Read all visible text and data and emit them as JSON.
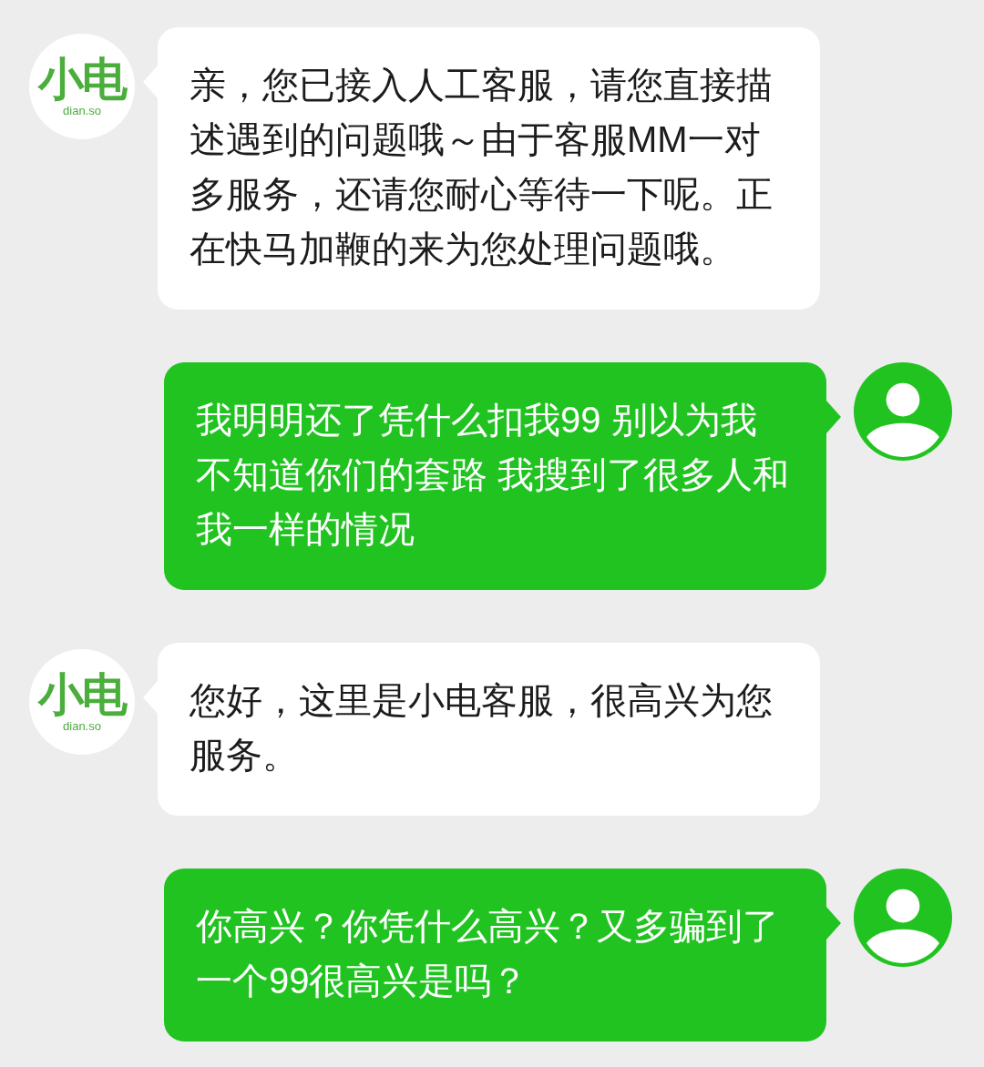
{
  "messages": [
    {
      "kind": "incoming",
      "avatar": {
        "kind": "logo",
        "mark": "小电",
        "caption": "dian.so"
      },
      "text": "亲，您已接入人工客服，请您直接描述遇到的问题哦～由于客服MM一对多服务，还请您耐心等待一下呢。正在快马加鞭的来为您处理问题哦。"
    },
    {
      "kind": "outgoing",
      "avatar": {
        "kind": "silhouette"
      },
      "text": "我明明还了凭什么扣我99 别以为我不知道你们的套路 我搜到了很多人和我一样的情况"
    },
    {
      "kind": "incoming",
      "avatar": {
        "kind": "logo",
        "mark": "小电",
        "caption": "dian.so"
      },
      "text": "您好，这里是小电客服，很高兴为您服务。"
    },
    {
      "kind": "outgoing",
      "avatar": {
        "kind": "silhouette"
      },
      "text": "你高兴？你凭什么高兴？又多骗到了一个99很高兴是吗？"
    }
  ]
}
